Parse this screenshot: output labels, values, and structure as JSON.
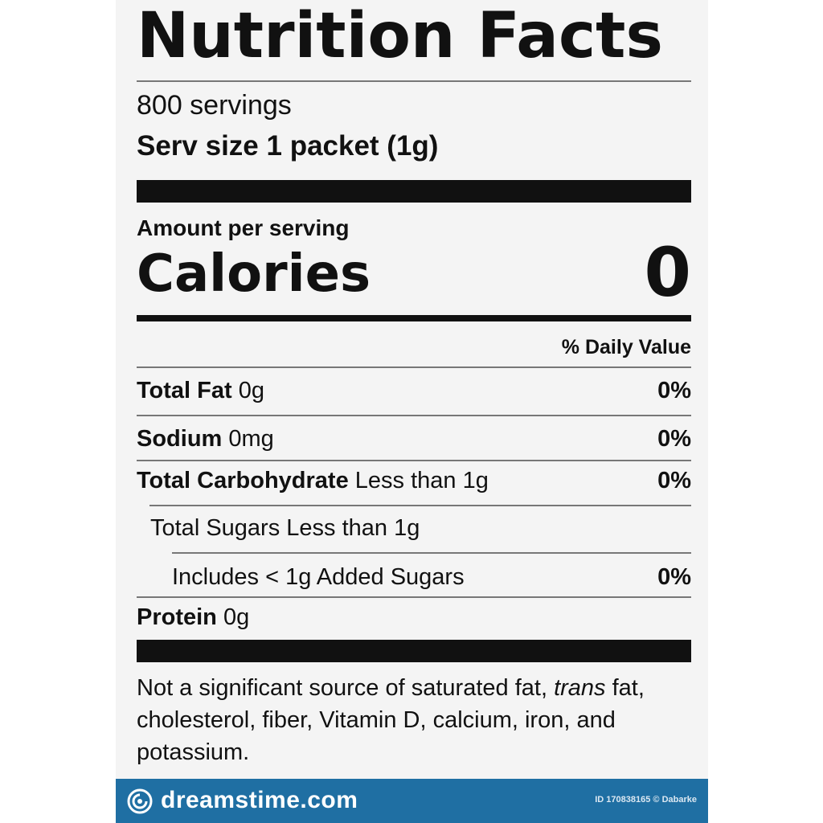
{
  "label": {
    "title": "Nutrition Facts",
    "servings": "800 servings",
    "serving_size": "Serv size 1 packet (1g)",
    "amount_per_serving": "Amount per serving",
    "calories_label": "Calories",
    "calories_value": "0",
    "daily_value_header": "% Daily Value",
    "nutrients": [
      {
        "name": "Total Fat",
        "amount": "0g",
        "pct": "0%"
      },
      {
        "name": "Sodium",
        "amount": "0mg",
        "pct": "0%"
      },
      {
        "name": "Total Carbohydrate",
        "amount": "Less than 1g",
        "pct": "0%"
      },
      {
        "name": "",
        "amount": "Total Sugars Less than 1g",
        "pct": ""
      },
      {
        "name": "",
        "amount": "Includes < 1g Added Sugars",
        "pct": "0%"
      },
      {
        "name": "Protein",
        "amount": "0g",
        "pct": ""
      }
    ],
    "footnote_before": "Not a significant source of saturated fat, ",
    "footnote_italic": "trans",
    "footnote_after": " fat, cholesterol, fiber, Vitamin D, calcium, iron, and potassium."
  },
  "footer": {
    "brand": "dreamstime.com",
    "credit": "ID 170838165 © Dabarke",
    "color": "#1f6fa3"
  }
}
